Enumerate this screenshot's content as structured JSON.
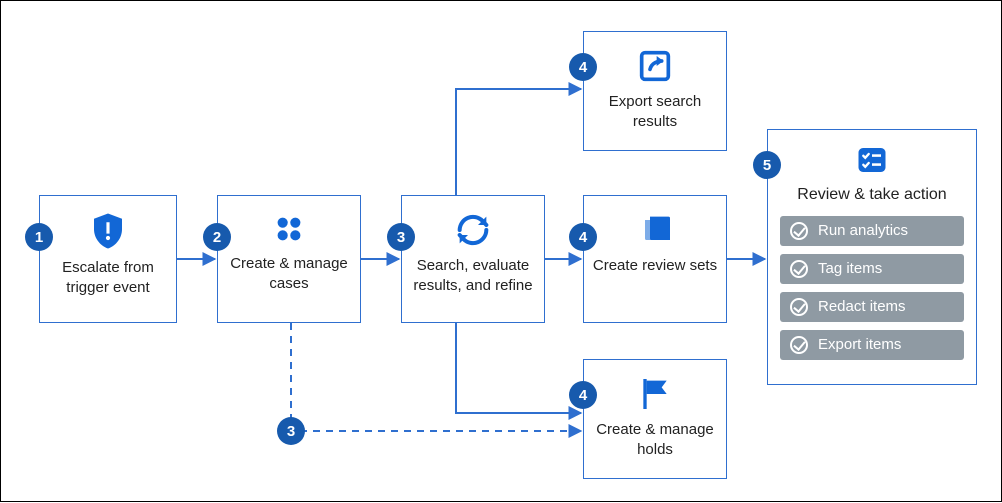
{
  "diagram": {
    "nodes": {
      "escalate": {
        "badge": "1",
        "label": "Escalate from trigger event"
      },
      "cases": {
        "badge": "2",
        "label": "Create & manage cases"
      },
      "search": {
        "badge": "3",
        "label": "Search, evaluate results, and refine"
      },
      "export": {
        "badge": "4",
        "label": "Export search results"
      },
      "reviewsets": {
        "badge": "4",
        "label": "Create review sets"
      },
      "holds": {
        "badge": "4",
        "label": "Create & manage holds"
      },
      "review": {
        "badge": "5",
        "label": "Review & take action"
      }
    },
    "dashed_badge": "3",
    "actions": [
      "Run analytics",
      "Tag items",
      "Redact items",
      "Export items"
    ]
  },
  "chart_data": {
    "type": "flow-diagram",
    "nodes": [
      {
        "id": "escalate",
        "step": 1,
        "label": "Escalate from trigger event"
      },
      {
        "id": "cases",
        "step": 2,
        "label": "Create & manage cases"
      },
      {
        "id": "search",
        "step": 3,
        "label": "Search, evaluate results, and refine"
      },
      {
        "id": "export",
        "step": 4,
        "label": "Export search results"
      },
      {
        "id": "reviewsets",
        "step": 4,
        "label": "Create review sets"
      },
      {
        "id": "holds",
        "step": 4,
        "label": "Create & manage holds"
      },
      {
        "id": "review",
        "step": 5,
        "label": "Review & take action",
        "sub_actions": [
          "Run analytics",
          "Tag items",
          "Redact items",
          "Export items"
        ]
      }
    ],
    "edges": [
      {
        "from": "escalate",
        "to": "cases",
        "style": "solid"
      },
      {
        "from": "cases",
        "to": "search",
        "style": "solid"
      },
      {
        "from": "search",
        "to": "export",
        "style": "solid"
      },
      {
        "from": "search",
        "to": "reviewsets",
        "style": "solid"
      },
      {
        "from": "search",
        "to": "holds",
        "style": "solid"
      },
      {
        "from": "cases",
        "to": "holds",
        "style": "dashed",
        "via_step": 3
      },
      {
        "from": "reviewsets",
        "to": "review",
        "style": "solid"
      }
    ]
  }
}
